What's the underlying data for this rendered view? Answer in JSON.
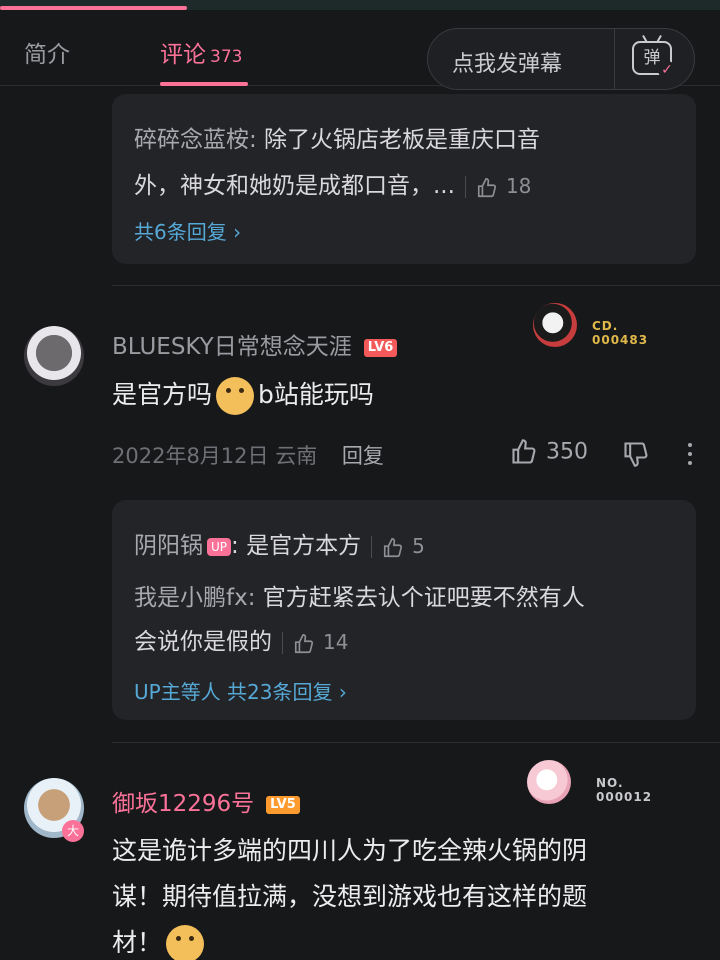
{
  "player": {
    "progress_fraction": 0.26
  },
  "tabs": {
    "intro_label": "简介",
    "comments_label": "评论",
    "comments_count": "373"
  },
  "danmaku": {
    "placeholder_label": "点我发弹幕",
    "icon_text": "弹",
    "icon": "danmaku-toggle-icon"
  },
  "comment_prev": {
    "replies": [
      {
        "author": "碎碎念蓝桉:",
        "text_line1": " 除了火锅店老板是重庆口音",
        "text_line2": "外，神女和她奶是成都口音，...",
        "likes": "18"
      }
    ],
    "more_link": "共6条回复 ›"
  },
  "comment1": {
    "username": "BLUESKY日常想念天涯",
    "level": "LV6",
    "fan_number": "CD.\n000483",
    "content_before_emoji": "是官方吗",
    "content_after_emoji": "b站能玩吗",
    "date": "2022年8月12日",
    "location": "云南",
    "reply_label": "回复",
    "likes": "350",
    "replies": [
      {
        "author": "阴阳锅",
        "badge": "UP",
        "text": ": 是官方本方",
        "likes": "5"
      },
      {
        "author": "我是小鹏fx:",
        "text_line1": " 官方赶紧去认个证吧要不然有人",
        "text_line2": "会说你是假的",
        "likes": "14"
      }
    ],
    "more_link": "UP主等人 共23条回复 ›"
  },
  "comment2": {
    "username": "御坂12296号",
    "level": "LV5",
    "avatar_badge": "大",
    "fan_number": "NO.\n000012",
    "content_line1": "这是诡计多端的四川人为了吃全辣火锅的阴",
    "content_line2": "谋！期待值拉满，没想到游戏也有这样的题",
    "content_line3": "材！"
  },
  "colors": {
    "accent_pink": "#fb7299",
    "link_blue": "#56a8d6",
    "background": "#17181a",
    "reply_box": "#232427"
  }
}
